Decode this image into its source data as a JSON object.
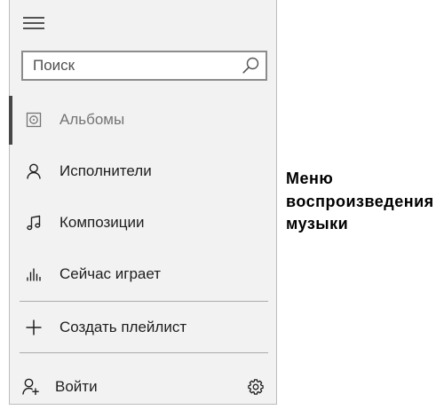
{
  "sidebar": {
    "menu_icon": "hamburger-icon",
    "search": {
      "placeholder": "Поиск",
      "icon": "search-icon"
    },
    "items": [
      {
        "label": "Альбомы",
        "icon": "album-icon",
        "selected": true
      },
      {
        "label": "Исполнители",
        "icon": "artist-icon",
        "selected": false
      },
      {
        "label": "Композиции",
        "icon": "music-note-icon",
        "selected": false
      },
      {
        "label": "Сейчас играет",
        "icon": "now-playing-icon",
        "selected": false
      }
    ],
    "create_playlist": {
      "label": "Создать плейлист",
      "icon": "plus-icon"
    },
    "sign_in": {
      "label": "Войти",
      "icon": "add-user-icon"
    },
    "settings": {
      "icon": "gear-icon"
    }
  },
  "caption": {
    "lines": [
      "Меню",
      "воспроизведения",
      "музыки"
    ]
  },
  "colors": {
    "panel_background": "#f2f2f2",
    "panel_border": "#bcbcbc",
    "search_border": "#8c8c8c",
    "text": "#1e1e1e",
    "selected_text": "#747474",
    "selected_indicator": "#474747",
    "divider": "#ababab"
  }
}
